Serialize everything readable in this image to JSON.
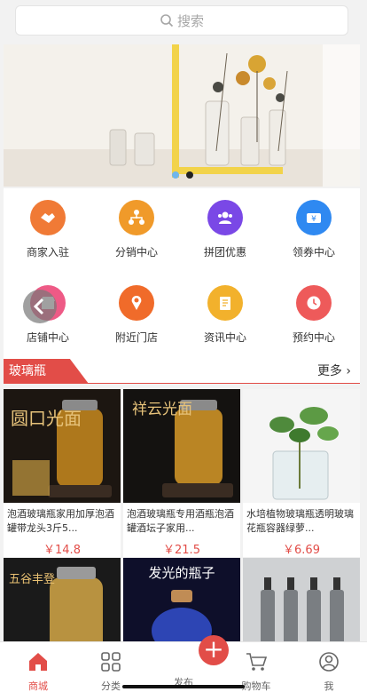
{
  "search": {
    "placeholder": "搜索"
  },
  "grid": [
    {
      "label": "商家入驻",
      "icon": "handshake-icon",
      "color": "#f07a36"
    },
    {
      "label": "分销中心",
      "icon": "share-network-icon",
      "color": "#f09a2a"
    },
    {
      "label": "拼团优惠",
      "icon": "group-icon",
      "color": "#7a48e6"
    },
    {
      "label": "领券中心",
      "icon": "coupon-icon",
      "color": "#2f89f1"
    },
    {
      "label": "店铺中心",
      "icon": "store-icon",
      "color": "#ee5a86"
    },
    {
      "label": "附近门店",
      "icon": "location-pin-icon",
      "color": "#f06b2a"
    },
    {
      "label": "资讯中心",
      "icon": "news-icon",
      "color": "#f2b12c"
    },
    {
      "label": "预约中心",
      "icon": "clock-icon",
      "color": "#ee5a5a"
    }
  ],
  "section": {
    "title": "玻璃瓶",
    "more": "更多"
  },
  "products": [
    {
      "title": "泡酒玻璃瓶家用加厚泡酒罐带龙头3斤5...",
      "price": "￥14.8"
    },
    {
      "title": "泡酒玻璃瓶专用酒瓶泡酒罐酒坛子家用...",
      "price": "￥21.5"
    },
    {
      "title": "水培植物玻璃瓶透明玻璃花瓶容器绿萝...",
      "price": "￥6.69"
    }
  ],
  "product_images": [
    {
      "text": "圆口光面"
    },
    {
      "text": "祥云光面"
    },
    {
      "text": ""
    },
    {
      "text": "五谷丰登"
    },
    {
      "text": "发光的瓶子"
    },
    {
      "text": ""
    }
  ],
  "tabs": [
    {
      "label": "商城",
      "icon": "home-icon",
      "active": true
    },
    {
      "label": "分类",
      "icon": "grid-icon",
      "active": false
    },
    {
      "label": "发布",
      "icon": "plus-icon",
      "active": false
    },
    {
      "label": "购物车",
      "icon": "cart-icon",
      "active": false
    },
    {
      "label": "我",
      "icon": "user-icon",
      "active": false
    }
  ]
}
